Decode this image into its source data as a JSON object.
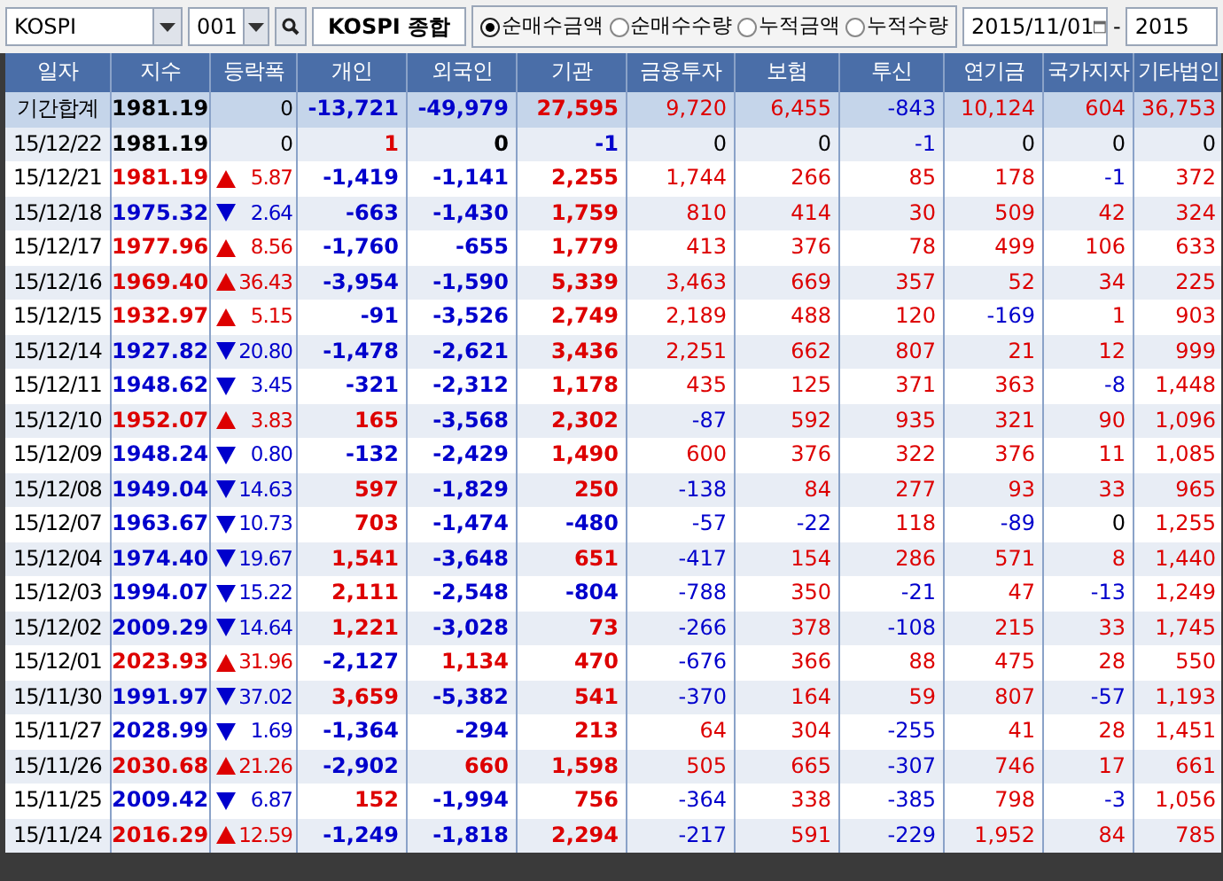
{
  "toolbar": {
    "market": "KOSPI",
    "code": "001",
    "index_name": "KOSPI 종합",
    "modes": [
      {
        "label": "순매수금액",
        "selected": true
      },
      {
        "label": "순매수수량",
        "selected": false
      },
      {
        "label": "누적금액",
        "selected": false
      },
      {
        "label": "누적수량",
        "selected": false
      }
    ],
    "date_from": "2015/11/01",
    "date_separator": "-",
    "date_to": "2015"
  },
  "table": {
    "columns": [
      "일자",
      "지수",
      "등락폭",
      "개인",
      "외국인",
      "기관",
      "금융투자",
      "보험",
      "투신",
      "연기금",
      "국가지자",
      "기타법인"
    ],
    "rows": [
      {
        "kind": "total",
        "date": "기간합계",
        "index": "1981.19",
        "up": false,
        "down": false,
        "change": "0",
        "values": [
          "-13,721",
          "-49,979",
          "27,595",
          "9,720",
          "6,455",
          "-843",
          "10,124",
          "604",
          "36,753"
        ]
      },
      {
        "kind": "day",
        "date": "15/12/22",
        "index": "1981.19",
        "up": false,
        "down": false,
        "change": "0",
        "values": [
          "1",
          "0",
          "-1",
          "0",
          "0",
          "-1",
          "0",
          "0",
          "0"
        ]
      },
      {
        "kind": "day",
        "date": "15/12/21",
        "index": "1981.19",
        "up": true,
        "down": false,
        "change": "5.87",
        "values": [
          "-1,419",
          "-1,141",
          "2,255",
          "1,744",
          "266",
          "85",
          "178",
          "-1",
          "372"
        ]
      },
      {
        "kind": "day",
        "date": "15/12/18",
        "index": "1975.32",
        "up": false,
        "down": true,
        "change": "2.64",
        "values": [
          "-663",
          "-1,430",
          "1,759",
          "810",
          "414",
          "30",
          "509",
          "42",
          "324"
        ]
      },
      {
        "kind": "day",
        "date": "15/12/17",
        "index": "1977.96",
        "up": true,
        "down": false,
        "change": "8.56",
        "values": [
          "-1,760",
          "-655",
          "1,779",
          "413",
          "376",
          "78",
          "499",
          "106",
          "633"
        ]
      },
      {
        "kind": "day",
        "date": "15/12/16",
        "index": "1969.40",
        "up": true,
        "down": false,
        "change": "36.43",
        "values": [
          "-3,954",
          "-1,590",
          "5,339",
          "3,463",
          "669",
          "357",
          "52",
          "34",
          "225"
        ]
      },
      {
        "kind": "day",
        "date": "15/12/15",
        "index": "1932.97",
        "up": true,
        "down": false,
        "change": "5.15",
        "values": [
          "-91",
          "-3,526",
          "2,749",
          "2,189",
          "488",
          "120",
          "-169",
          "1",
          "903"
        ]
      },
      {
        "kind": "day",
        "date": "15/12/14",
        "index": "1927.82",
        "up": false,
        "down": true,
        "change": "20.80",
        "values": [
          "-1,478",
          "-2,621",
          "3,436",
          "2,251",
          "662",
          "807",
          "21",
          "12",
          "999"
        ]
      },
      {
        "kind": "day",
        "date": "15/12/11",
        "index": "1948.62",
        "up": false,
        "down": true,
        "change": "3.45",
        "values": [
          "-321",
          "-2,312",
          "1,178",
          "435",
          "125",
          "371",
          "363",
          "-8",
          "1,448"
        ]
      },
      {
        "kind": "day",
        "date": "15/12/10",
        "index": "1952.07",
        "up": true,
        "down": false,
        "change": "3.83",
        "values": [
          "165",
          "-3,568",
          "2,302",
          "-87",
          "592",
          "935",
          "321",
          "90",
          "1,096"
        ]
      },
      {
        "kind": "day",
        "date": "15/12/09",
        "index": "1948.24",
        "up": false,
        "down": true,
        "change": "0.80",
        "values": [
          "-132",
          "-2,429",
          "1,490",
          "600",
          "376",
          "322",
          "376",
          "11",
          "1,085"
        ]
      },
      {
        "kind": "day",
        "date": "15/12/08",
        "index": "1949.04",
        "up": false,
        "down": true,
        "change": "14.63",
        "values": [
          "597",
          "-1,829",
          "250",
          "-138",
          "84",
          "277",
          "93",
          "33",
          "965"
        ]
      },
      {
        "kind": "day",
        "date": "15/12/07",
        "index": "1963.67",
        "up": false,
        "down": true,
        "change": "10.73",
        "values": [
          "703",
          "-1,474",
          "-480",
          "-57",
          "-22",
          "118",
          "-89",
          "0",
          "1,255"
        ]
      },
      {
        "kind": "day",
        "date": "15/12/04",
        "index": "1974.40",
        "up": false,
        "down": true,
        "change": "19.67",
        "values": [
          "1,541",
          "-3,648",
          "651",
          "-417",
          "154",
          "286",
          "571",
          "8",
          "1,440"
        ]
      },
      {
        "kind": "day",
        "date": "15/12/03",
        "index": "1994.07",
        "up": false,
        "down": true,
        "change": "15.22",
        "values": [
          "2,111",
          "-2,548",
          "-804",
          "-788",
          "350",
          "-21",
          "47",
          "-13",
          "1,249"
        ]
      },
      {
        "kind": "day",
        "date": "15/12/02",
        "index": "2009.29",
        "up": false,
        "down": true,
        "change": "14.64",
        "values": [
          "1,221",
          "-3,028",
          "73",
          "-266",
          "378",
          "-108",
          "215",
          "33",
          "1,745"
        ]
      },
      {
        "kind": "day",
        "date": "15/12/01",
        "index": "2023.93",
        "up": true,
        "down": false,
        "change": "31.96",
        "values": [
          "-2,127",
          "1,134",
          "470",
          "-676",
          "366",
          "88",
          "475",
          "28",
          "550"
        ]
      },
      {
        "kind": "day",
        "date": "15/11/30",
        "index": "1991.97",
        "up": false,
        "down": true,
        "change": "37.02",
        "values": [
          "3,659",
          "-5,382",
          "541",
          "-370",
          "164",
          "59",
          "807",
          "-57",
          "1,193"
        ]
      },
      {
        "kind": "day",
        "date": "15/11/27",
        "index": "2028.99",
        "up": false,
        "down": true,
        "change": "1.69",
        "values": [
          "-1,364",
          "-294",
          "213",
          "64",
          "304",
          "-255",
          "41",
          "28",
          "1,451"
        ]
      },
      {
        "kind": "day",
        "date": "15/11/26",
        "index": "2030.68",
        "up": true,
        "down": false,
        "change": "21.26",
        "values": [
          "-2,902",
          "660",
          "1,598",
          "505",
          "665",
          "-307",
          "746",
          "17",
          "661"
        ]
      },
      {
        "kind": "day",
        "date": "15/11/25",
        "index": "2009.42",
        "up": false,
        "down": true,
        "change": "6.87",
        "values": [
          "152",
          "-1,994",
          "756",
          "-364",
          "338",
          "-385",
          "798",
          "-3",
          "1,056"
        ]
      },
      {
        "kind": "day",
        "date": "15/11/24",
        "index": "2016.29",
        "up": true,
        "down": false,
        "change": "12.59",
        "values": [
          "-1,249",
          "-1,818",
          "2,294",
          "-217",
          "591",
          "-229",
          "1,952",
          "84",
          "785"
        ]
      }
    ]
  }
}
